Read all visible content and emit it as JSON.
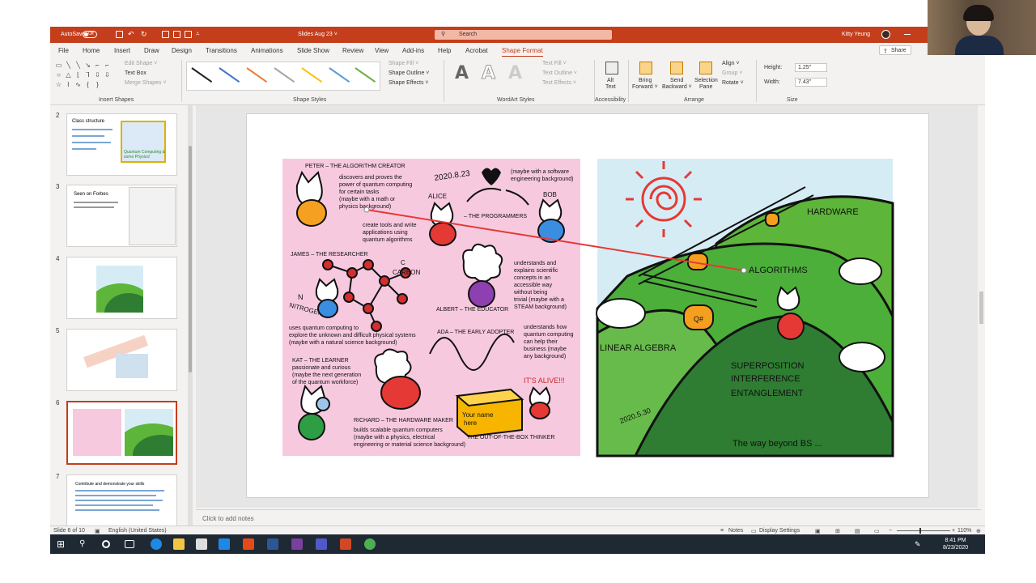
{
  "titlebar": {
    "autosave_label": "AutoSave",
    "autosave_state": "Off",
    "file_title": "Slides Aug 23 ˅",
    "search_placeholder": "Search",
    "user_name": "Kitty Yeung"
  },
  "tabs": [
    {
      "label": "File"
    },
    {
      "label": "Home"
    },
    {
      "label": "Insert"
    },
    {
      "label": "Draw"
    },
    {
      "label": "Design"
    },
    {
      "label": "Transitions"
    },
    {
      "label": "Animations"
    },
    {
      "label": "Slide Show"
    },
    {
      "label": "Review"
    },
    {
      "label": "View"
    },
    {
      "label": "Add-ins"
    },
    {
      "label": "Help"
    },
    {
      "label": "Acrobat"
    },
    {
      "label": "Shape Format"
    }
  ],
  "active_tab": "Shape Format",
  "share_label": "Share",
  "ribbon": {
    "edit_shape": "Edit Shape ˅",
    "text_box": "Text Box",
    "merge_shapes": "Merge Shapes ˅",
    "insert_shapes_label": "Insert Shapes",
    "shape_fill": "Shape Fill ˅",
    "shape_outline": "Shape Outline ˅",
    "shape_effects": "Shape Effects ˅",
    "shape_styles_label": "Shape Styles",
    "text_fill": "Text Fill ˅",
    "text_outline": "Text Outline ˅",
    "text_effects": "Text Effects ˅",
    "wordart_label": "WordArt Styles",
    "alt_text_1": "Alt",
    "alt_text_2": "Text",
    "accessibility_label": "Accessibility",
    "bring_forward_1": "Bring",
    "bring_forward_2": "Forward ˅",
    "send_backward_1": "Send",
    "send_backward_2": "Backward ˅",
    "selection_pane_1": "Selection",
    "selection_pane_2": "Pane",
    "align": "Align ˅",
    "group": "Group ˅",
    "rotate": "Rotate ˅",
    "arrange_label": "Arrange",
    "height_label": "Height:",
    "height_value": "1.25\"",
    "width_label": "Width:",
    "width_value": "7.43\"",
    "size_label": "Size"
  },
  "thumbnails": [
    {
      "number": "2",
      "title": "Class structure",
      "subtitle": "Quantum Computing & some Physics!"
    },
    {
      "number": "3",
      "title": "Seen on Forbes"
    },
    {
      "number": "4"
    },
    {
      "number": "5"
    },
    {
      "number": "6",
      "selected": true
    },
    {
      "number": "7",
      "title": "Contribute and demonstrate your skills"
    }
  ],
  "slide": {
    "left": {
      "peter_title": "PETER – THE ALGORITHM CREATOR",
      "peter_desc": [
        "discovers and proves the",
        "power of quantum computing",
        "for certain tasks",
        "(maybe with a math or",
        "physics background)"
      ],
      "date_left": "2020.8.23",
      "software_bg": [
        "(maybe with a software",
        "engineering background)"
      ],
      "alice": "ALICE",
      "bob": "BOB",
      "programmers": "– THE PROGRAMMERS",
      "programmers_desc": [
        "create tools and write",
        "applications using",
        "quantum algorithms"
      ],
      "james_title": "JAMES – THE RESEARCHER",
      "carbon": "CARBON",
      "carbon_c": "C",
      "nitrogen": "NITROGEN",
      "nitrogen_n": "N",
      "albert_desc": [
        "understands and",
        "explains scientific",
        "concepts in an",
        "accessible way",
        "without being",
        "trivial (maybe with a",
        "STEAM background)"
      ],
      "albert_title": "ALBERT – THE EDUCATOR",
      "james_desc": [
        "uses quantum computing to",
        "explore the unknown and difficult physical systems",
        "(maybe with a natural science background)"
      ],
      "ada_title": "ADA – THE EARLY ADOPTER",
      "ada_desc": [
        "understands how",
        "quantum computing",
        "can help their",
        "business (maybe",
        "any background)"
      ],
      "kat_title": "KAT – THE LEARNER",
      "kat_desc": [
        "passionate and curious",
        "(maybe the next generation",
        "of the quantum workforce)"
      ],
      "alive": "IT'S ALIVE!!!",
      "box_text_1": "Your name",
      "box_text_2": "here",
      "richard_title": "RICHARD – THE HARDWARE MAKER",
      "richard_desc": [
        "builds scalable quantum computers",
        "(maybe with a physics, electrical",
        "engineering or material science background)"
      ],
      "thinker": "THE OUT-OF-THE-BOX THINKER"
    },
    "right": {
      "hardware": "HARDWARE",
      "algorithms": "ALGORITHMS",
      "qsharp": "Q#",
      "linear_algebra": "LINEAR ALGEBRA",
      "superposition": "SUPERPOSITION",
      "interference": "INTERFERENCE",
      "entanglement": "ENTANGLEMENT",
      "date_right": "2020.5.30",
      "beyond": "The way beyond BS ..."
    }
  },
  "notes_placeholder": "Click to add notes",
  "status": {
    "slide_count": "Slide 6 of 10",
    "language": "English (United States)",
    "notes": "Notes",
    "display_settings": "Display Settings",
    "zoom": "110%"
  },
  "taskbar": {
    "time": "8:41 PM",
    "date": "8/23/2020"
  },
  "colors": {
    "accent": "#c43e1c",
    "pink_panel": "#f7c9df",
    "sky": "#d6ecf5",
    "hill_light": "#5db53a",
    "hill_dark": "#2e7d32"
  }
}
